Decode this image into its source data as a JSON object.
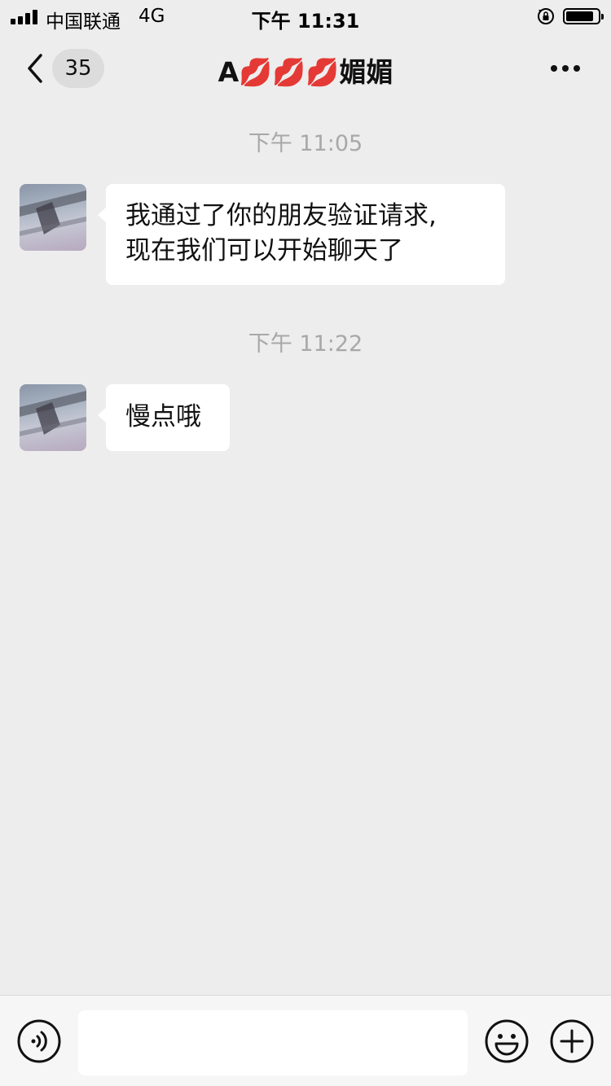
{
  "status_bar": {
    "carrier": "中国联通",
    "network": "4G",
    "time": "下午 11:31"
  },
  "nav": {
    "unread_count": "35",
    "title": "A💋💋💋媚媚"
  },
  "messages": [
    {
      "timestamp": "下午 11:05",
      "text_lines": [
        "我通过了你的朋友验证请求,",
        "现在我们可以开始聊天了"
      ]
    },
    {
      "timestamp": "下午 11:22",
      "text_lines": [
        "慢点哦"
      ]
    }
  ],
  "input_bar": {
    "placeholder": ""
  },
  "icons": [
    "chevron-left-icon",
    "more-dots-icon",
    "voice-icon",
    "emoji-icon",
    "plus-icon",
    "rotation-lock-icon",
    "battery-icon",
    "signal-icon"
  ],
  "colors": {
    "background": "#ededed",
    "bubble": "#ffffff",
    "timestamp": "#a8a8a8",
    "badge": "#dcdcdc"
  }
}
